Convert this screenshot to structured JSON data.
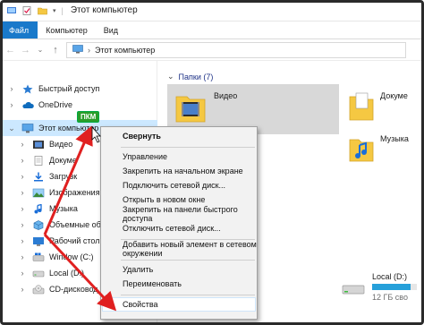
{
  "window": {
    "title": "Этот компьютер"
  },
  "ribbon": {
    "tabs": [
      "Файл",
      "Компьютер",
      "Вид"
    ]
  },
  "address": {
    "path": "Этот компьютер"
  },
  "nav": {
    "items": [
      {
        "label": "Быстрый доступ",
        "icon": "star-icon",
        "selected": false,
        "child": false,
        "expanded": false
      },
      {
        "label": "OneDrive",
        "icon": "cloud-icon",
        "selected": false,
        "child": false,
        "expanded": false
      },
      {
        "label": "Этот компьютер",
        "icon": "computer-icon",
        "selected": true,
        "child": false,
        "expanded": true
      },
      {
        "label": "Видео",
        "icon": "video-folder-icon",
        "selected": false,
        "child": true,
        "expanded": false
      },
      {
        "label": "Докуме",
        "icon": "documents-folder-icon",
        "selected": false,
        "child": true,
        "expanded": false
      },
      {
        "label": "Загрузк",
        "icon": "downloads-folder-icon",
        "selected": false,
        "child": true,
        "expanded": false
      },
      {
        "label": "Изображения",
        "icon": "pictures-folder-icon",
        "selected": false,
        "child": true,
        "expanded": false
      },
      {
        "label": "Музыка",
        "icon": "music-folder-icon",
        "selected": false,
        "child": true,
        "expanded": false
      },
      {
        "label": "Объемные объ",
        "icon": "3d-objects-icon",
        "selected": false,
        "child": true,
        "expanded": false
      },
      {
        "label": "Рабочий стол",
        "icon": "desktop-folder-icon",
        "selected": false,
        "child": true,
        "expanded": false
      },
      {
        "label": "Window (C:)",
        "icon": "windows-drive-icon",
        "selected": false,
        "child": true,
        "expanded": false
      },
      {
        "label": "Local (D:)",
        "icon": "drive-icon",
        "selected": false,
        "child": true,
        "expanded": false
      },
      {
        "label": "CD-дисковод (E:)",
        "icon": "cd-drive-icon",
        "selected": false,
        "child": true,
        "expanded": false
      }
    ]
  },
  "content": {
    "group_header": "Папки (7)",
    "folders": [
      {
        "label": "Видео"
      },
      {
        "label": "Докуме"
      },
      {
        "label": "Музыка"
      }
    ],
    "drive": {
      "label": "Local (D:)",
      "free": "12 ГБ сво",
      "fill_fraction": 0.85
    }
  },
  "badge": {
    "text": "ПКМ"
  },
  "context_menu": {
    "items": [
      {
        "label": "Свернуть",
        "bold": true
      },
      {
        "sep": true
      },
      {
        "label": "Управление"
      },
      {
        "label": "Закрепить на начальном экране"
      },
      {
        "label": "Подключить сетевой диск..."
      },
      {
        "label": "Открыть в новом окне"
      },
      {
        "label": "Закрепить на панели быстрого доступа"
      },
      {
        "label": "Отключить сетевой диск..."
      },
      {
        "sep": true
      },
      {
        "label": "Добавить новый элемент в сетевом окружении"
      },
      {
        "sep": true
      },
      {
        "label": "Удалить"
      },
      {
        "label": "Переименовать"
      },
      {
        "sep": true
      },
      {
        "label": "Свойства",
        "hover": true
      }
    ]
  },
  "colors": {
    "accent": "#1979ca",
    "selection": "#cce8ff",
    "annotation": "#e02020",
    "badge": "#2a9d2a"
  }
}
